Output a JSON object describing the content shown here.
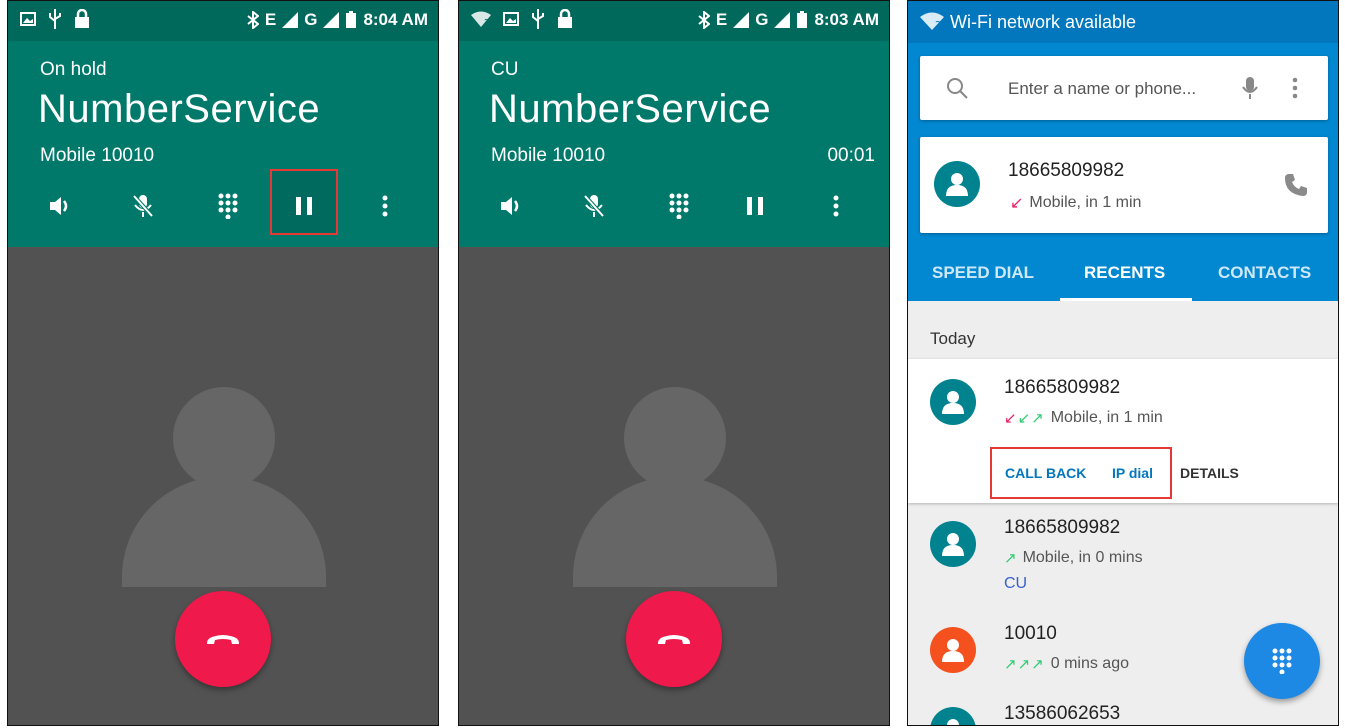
{
  "screens": [
    {
      "status_time": "8:04 AM",
      "call_state": "On hold",
      "contact_name": "NumberService",
      "contact_sub": "Mobile 10010",
      "timer": "",
      "controls": [
        "speaker-icon",
        "mute-icon",
        "dialpad-icon",
        "hold-icon",
        "more-options-icon"
      ]
    },
    {
      "status_time": "8:03 AM",
      "call_state": "CU",
      "contact_name": "NumberService",
      "contact_sub": "Mobile 10010",
      "timer": "00:01",
      "controls": [
        "speaker-icon",
        "mute-icon",
        "dialpad-icon",
        "hold-icon",
        "more-options-icon"
      ]
    }
  ],
  "network_labels": {
    "e": "E",
    "g": "G"
  },
  "dialer": {
    "status_text": "Wi-Fi network available",
    "search_placeholder": "Enter a name or phone...",
    "top_card": {
      "number": "18665809982",
      "meta": "Mobile, in 1 min"
    },
    "tabs": [
      "SPEED DIAL",
      "RECENTS",
      "CONTACTS"
    ],
    "section": "Today",
    "entries": [
      {
        "number": "18665809982",
        "meta": "Mobile, in 1 min",
        "actions": [
          "CALL BACK",
          "IP dial",
          "DETAILS"
        ]
      },
      {
        "number": "18665809982",
        "meta": "Mobile, in 0 mins",
        "extra": "CU"
      },
      {
        "number": "10010",
        "meta": "0 mins ago"
      },
      {
        "number": "13586062653"
      }
    ],
    "colors": {
      "accent": "#0288d1",
      "avatar_teal": "#00838f",
      "avatar_orange": "#f4511e",
      "incoming": "#e91e63",
      "outgoing": "#2ecc71"
    }
  }
}
